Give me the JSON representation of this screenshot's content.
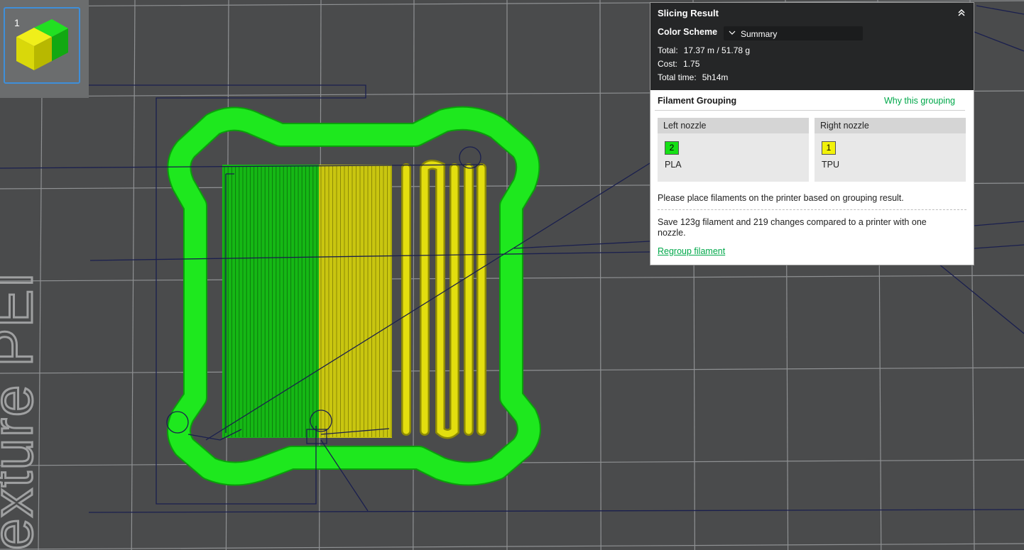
{
  "colors": {
    "background": "#4a4b4c",
    "grid": "#8f9193",
    "pla_green": "#16d616",
    "tpu_yellow": "#d9d60a",
    "travel": "#1a1f4e",
    "accent_green": "#00a84a",
    "thumb_border": "#3f8fd9"
  },
  "plate": {
    "number": "1",
    "icon": "cube-icon"
  },
  "watermark_text": "exture PEI",
  "slicing_result": {
    "title": "Slicing Result",
    "collapse_icon": "chevron-double-up-icon",
    "color_scheme_label": "Color Scheme",
    "color_scheme_value": "Summary",
    "total_label": "Total:",
    "total_value": "17.37 m / 51.78 g",
    "cost_label": "Cost:",
    "cost_value": "1.75",
    "time_label": "Total time:",
    "time_value": "5h14m"
  },
  "filament_grouping": {
    "title": "Filament Grouping",
    "why_link": "Why this grouping",
    "left_nozzle": {
      "label": "Left nozzle",
      "slot": "2",
      "material": "PLA",
      "color": "#16e016"
    },
    "right_nozzle": {
      "label": "Right nozzle",
      "slot": "1",
      "material": "TPU",
      "color": "#f2f20a"
    },
    "place_text": "Please place filaments on the printer based on grouping result.",
    "save_text": "Save 123g filament and 219 changes compared to a printer with one nozzle.",
    "regroup_link": "Regroup filament"
  }
}
